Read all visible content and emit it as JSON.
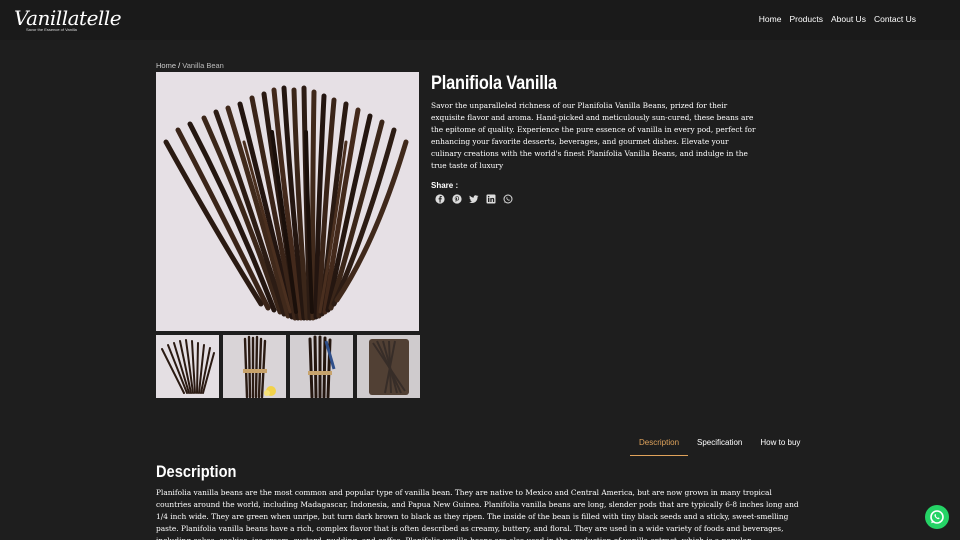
{
  "brand": {
    "name": "Vanillatelle",
    "tagline": "Savor the Essence of Vanilla"
  },
  "nav": {
    "items": [
      "Home",
      "Products",
      "About Us",
      "Contact Us"
    ]
  },
  "breadcrumb": {
    "home": "Home",
    "separator": "/",
    "current": "Vanilla Bean"
  },
  "product": {
    "title": "Planifiola Vanilla",
    "short_description": "Savor the unparalleled richness of our Planifolia Vanilla Beans, prized for their exquisite flavor and aroma. Hand-picked and meticulously sun-cured, these beans are the epitome of quality. Experience the pure essence of vanilla in every pod, perfect for enhancing your favorite desserts, beverages, and gourmet dishes. Elevate your culinary creations with the world's finest Planifolia Vanilla Beans, and indulge in the true taste of luxury",
    "share_label": "Share :",
    "share_icons": [
      "facebook-icon",
      "pinterest-icon",
      "twitter-icon",
      "linkedin-icon",
      "whatsapp-icon"
    ]
  },
  "tabs": [
    {
      "label": "Description",
      "active": true
    },
    {
      "label": "Specification",
      "active": false
    },
    {
      "label": "How to buy",
      "active": false
    }
  ],
  "description": {
    "heading": "Description",
    "body": "Planifolia vanilla beans are the most common and popular type of vanilla bean. They are native to Mexico and Central America, but are now grown in many tropical countries around the world, including Madagascar, Indonesia, and Papua New Guinea. Planifolia vanilla beans are long, slender pods that are typically 6-8 inches long and 1/4 inch wide. They are green when unripe, but turn dark brown to black as they ripen. The inside of the bean is filled with tiny black seeds and a sticky, sweet-smelling paste. Planifolia vanilla beans have a rich, complex flavor that is often described as creamy, buttery, and floral. They are used in a wide variety of foods and beverages, including cakes, cookies, ice cream, custard, pudding, and coffee. Planifolia vanilla beans are also used in the production of vanilla extract, which is a popular"
  },
  "colors": {
    "background": "#1e1e1e",
    "accent": "#e0a35b",
    "whatsapp": "#25d366"
  }
}
